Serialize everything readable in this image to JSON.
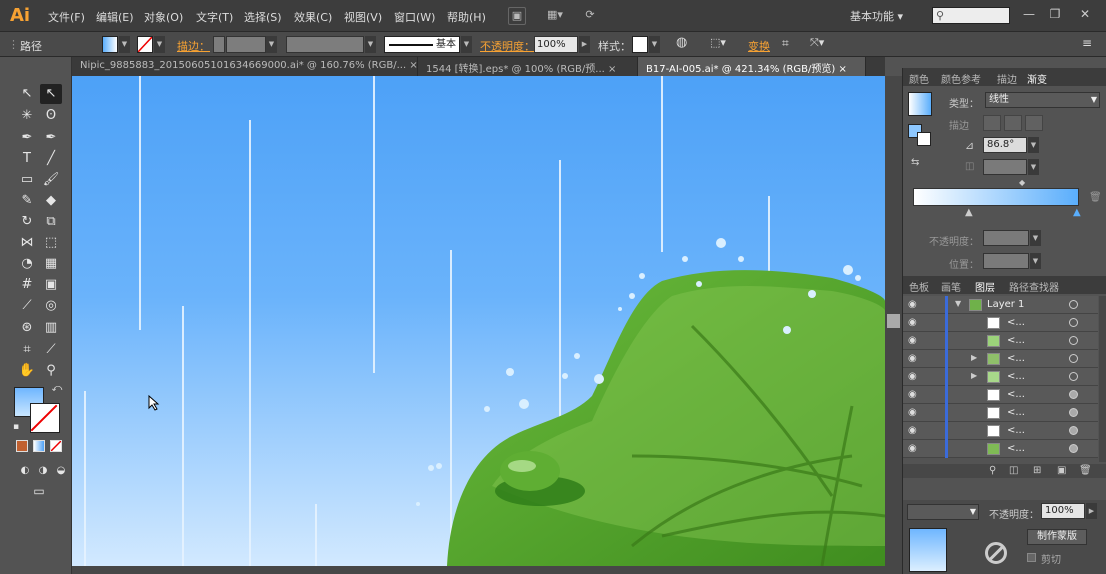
{
  "app": {
    "logo": "Ai"
  },
  "menu": [
    "文件(F)",
    "编辑(E)",
    "对象(O)",
    "文字(T)",
    "选择(S)",
    "效果(C)",
    "视图(V)",
    "窗口(W)",
    "帮助(H)"
  ],
  "workspace": "基本功能",
  "control": {
    "selection": "路径",
    "stroke_label": "描边：",
    "brush": "基本",
    "opacity_label": "不透明度：",
    "opacity_value": "100%",
    "style_label": "样式：",
    "transform_label": "变换"
  },
  "tabs": [
    {
      "label": "Nipic_9885883_20150605101634669000.ai* @ 160.76% (RGB/...",
      "close": "×"
    },
    {
      "label": "1544 [转换].eps* @ 100% (RGB/预...",
      "close": "×"
    },
    {
      "label": "B17-AI-005.ai* @ 421.34% (RGB/预览)",
      "close": "×"
    }
  ],
  "gradient_panel": {
    "tabs": [
      "颜色",
      "颜色参考",
      "描边",
      "渐变"
    ],
    "type_label": "类型：",
    "type_value": "线性",
    "stroke_label": "描边",
    "angle": "86.8°",
    "opacity_label": "不透明度：",
    "position_label": "位置："
  },
  "layers_panel": {
    "tabs": [
      "色板",
      "画笔",
      "图层",
      "路径查找器"
    ],
    "layer_name": "Layer 1",
    "sublayer_label": "<...",
    "rows": 8
  },
  "bottom_panel": {
    "opacity_label": "不透明度：",
    "opacity_value": "100%",
    "mask_button": "制作蒙版",
    "clip_label": "剪切"
  },
  "colors": {
    "sky_top": "#4da1f7",
    "sky_bottom": "#cfe7ff",
    "leaf": "#5aa82d",
    "leaf_light": "#84c651",
    "accent": "#f7a233"
  }
}
